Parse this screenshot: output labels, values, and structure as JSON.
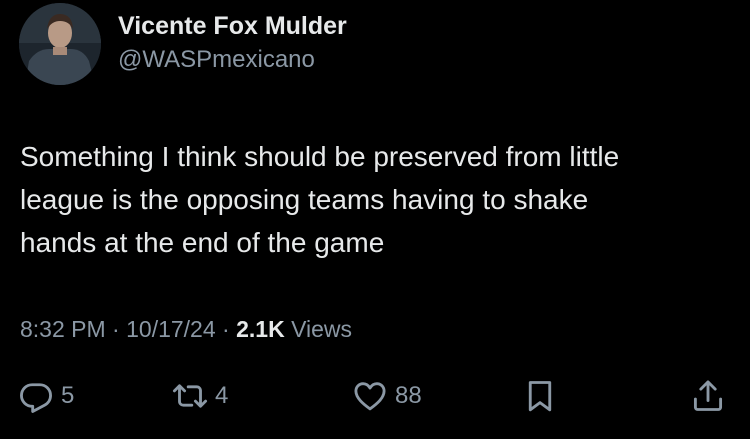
{
  "author": {
    "display_name": "Vicente Fox Mulder",
    "handle": "@WASPmexicano"
  },
  "tweet": {
    "lines": [
      "Something I think should be preserved from little",
      "league is the opposing teams having to shake",
      "hands at the end of the game"
    ]
  },
  "meta": {
    "time": "8:32 PM",
    "separator": "·",
    "date": "10/17/24",
    "views_count": "2.1K",
    "views_label": "Views"
  },
  "actions": {
    "reply_count": "5",
    "retweet_count": "4",
    "like_count": "88"
  },
  "icons": {
    "reply": "reply-icon",
    "retweet": "retweet-icon",
    "like": "heart-icon",
    "bookmark": "bookmark-icon",
    "share": "share-icon"
  },
  "colors": {
    "background": "#000000",
    "primary_text": "#e7e9ea",
    "secondary_text": "#8b98a5"
  }
}
